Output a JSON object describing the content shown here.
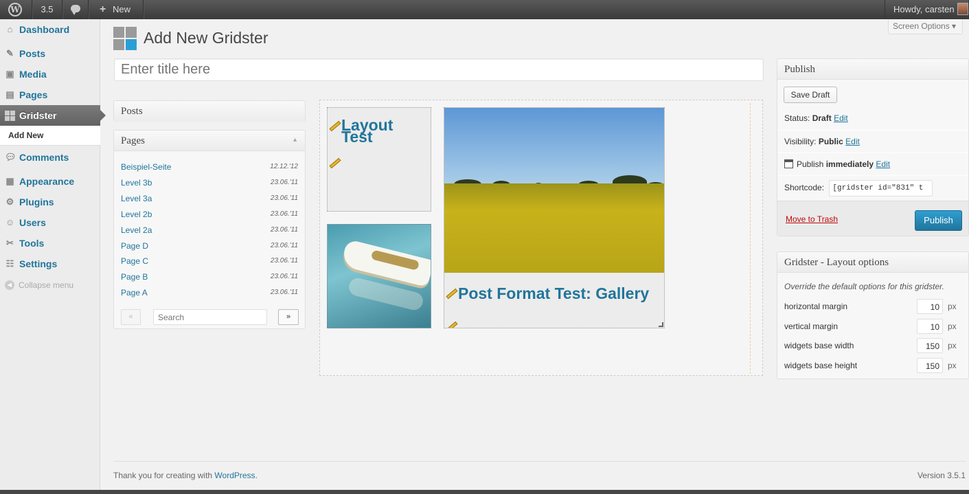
{
  "adminbar": {
    "version": "3.5",
    "new_label": "New",
    "howdy": "Howdy, carsten"
  },
  "sidebar": {
    "items": [
      {
        "label": "Dashboard",
        "icon": "dashboard-icon"
      },
      {
        "label": "Posts",
        "icon": "pin-icon"
      },
      {
        "label": "Media",
        "icon": "media-icon"
      },
      {
        "label": "Pages",
        "icon": "pages-icon"
      },
      {
        "label": "Gridster",
        "icon": "grid-icon"
      },
      {
        "label": "Comments",
        "icon": "comment-icon"
      },
      {
        "label": "Appearance",
        "icon": "appearance-icon"
      },
      {
        "label": "Plugins",
        "icon": "plugin-icon"
      },
      {
        "label": "Users",
        "icon": "users-icon"
      },
      {
        "label": "Tools",
        "icon": "tools-icon"
      },
      {
        "label": "Settings",
        "icon": "settings-icon"
      }
    ],
    "submenu_add_new": "Add New",
    "collapse": "Collapse menu"
  },
  "header": {
    "screen_options": "Screen Options ▾",
    "title": "Add New Gridster",
    "title_placeholder": "Enter title here"
  },
  "posts_box": {
    "title": "Posts"
  },
  "pages_box": {
    "title": "Pages",
    "rows": [
      {
        "title": "Beispiel-Seite",
        "date": "12.12.'12"
      },
      {
        "title": "Level 3b",
        "date": "23.06.'11"
      },
      {
        "title": "Level 3a",
        "date": "23.06.'11"
      },
      {
        "title": "Level 2b",
        "date": "23.06.'11"
      },
      {
        "title": "Level 2a",
        "date": "23.06.'11"
      },
      {
        "title": "Page D",
        "date": "23.06.'11"
      },
      {
        "title": "Page C",
        "date": "23.06.'11"
      },
      {
        "title": "Page B",
        "date": "23.06.'11"
      },
      {
        "title": "Page A",
        "date": "23.06.'11"
      }
    ],
    "prev": "«",
    "next": "»",
    "search_placeholder": "Search"
  },
  "grid": {
    "widget_layout_title": "Layout Test",
    "widget_gallery_title": "Post Format Test: Gallery"
  },
  "publish": {
    "title": "Publish",
    "save_draft": "Save Draft",
    "status_label": "Status:",
    "status_value": "Draft",
    "visibility_label": "Visibility:",
    "visibility_value": "Public",
    "publish_label": "Publish",
    "publish_value": "immediately",
    "edit": "Edit",
    "shortcode_label": "Shortcode:",
    "shortcode_value": "[gridster id=\"831\" t",
    "trash": "Move to Trash",
    "publish_button": "Publish"
  },
  "layout_options": {
    "title": "Gridster - Layout options",
    "description": "Override the default options for this gridster.",
    "unit": "px",
    "options": [
      {
        "label": "horizontal margin",
        "value": "10"
      },
      {
        "label": "vertical margin",
        "value": "10"
      },
      {
        "label": "widgets base width",
        "value": "150"
      },
      {
        "label": "widgets base height",
        "value": "150"
      }
    ]
  },
  "footer": {
    "thanks": "Thank you for creating with",
    "wordpress": "WordPress",
    "period": ".",
    "version": "Version 3.5.1"
  },
  "colors": {
    "link": "#21759b",
    "adminbar": "#464646",
    "publish_button": "#21759b",
    "trash": "#bc0b0b"
  }
}
